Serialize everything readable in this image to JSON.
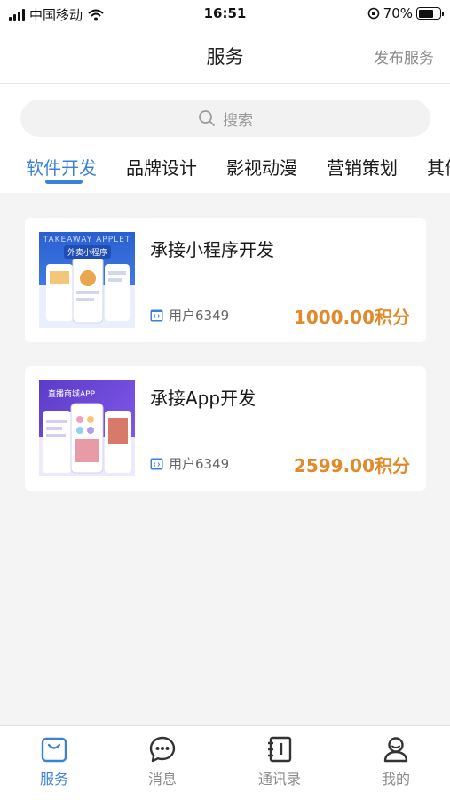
{
  "status_bar": {
    "carrier": "中国移动",
    "time": "16:51",
    "battery": "70%",
    "battery_level": 0.7
  },
  "header": {
    "title": "服务",
    "action": "发布服务"
  },
  "search": {
    "placeholder": "搜索"
  },
  "tabs": [
    {
      "label": "软件开发",
      "active": true
    },
    {
      "label": "品牌设计",
      "active": false
    },
    {
      "label": "影视动漫",
      "active": false
    },
    {
      "label": "营销策划",
      "active": false
    },
    {
      "label": "其他",
      "active": false
    }
  ],
  "cards": [
    {
      "title": "承接小程序开发",
      "user": "用户6349",
      "price": "1000.00积分",
      "thumb_caption": "外卖小程序",
      "thumb_watermark": "TAKEAWAY APPLET"
    },
    {
      "title": "承接App开发",
      "user": "用户6349",
      "price": "2599.00积分",
      "thumb_caption": "直播商城APP"
    }
  ],
  "tabbar": [
    {
      "label": "服务",
      "icon": "bag-icon",
      "active": true
    },
    {
      "label": "消息",
      "icon": "chat-icon",
      "active": false
    },
    {
      "label": "通讯录",
      "icon": "contacts-icon",
      "active": false
    },
    {
      "label": "我的",
      "icon": "profile-icon",
      "active": false
    }
  ],
  "colors": {
    "accent": "#3b82d6",
    "price": "#e08a2b",
    "background": "#f4f4f5"
  }
}
